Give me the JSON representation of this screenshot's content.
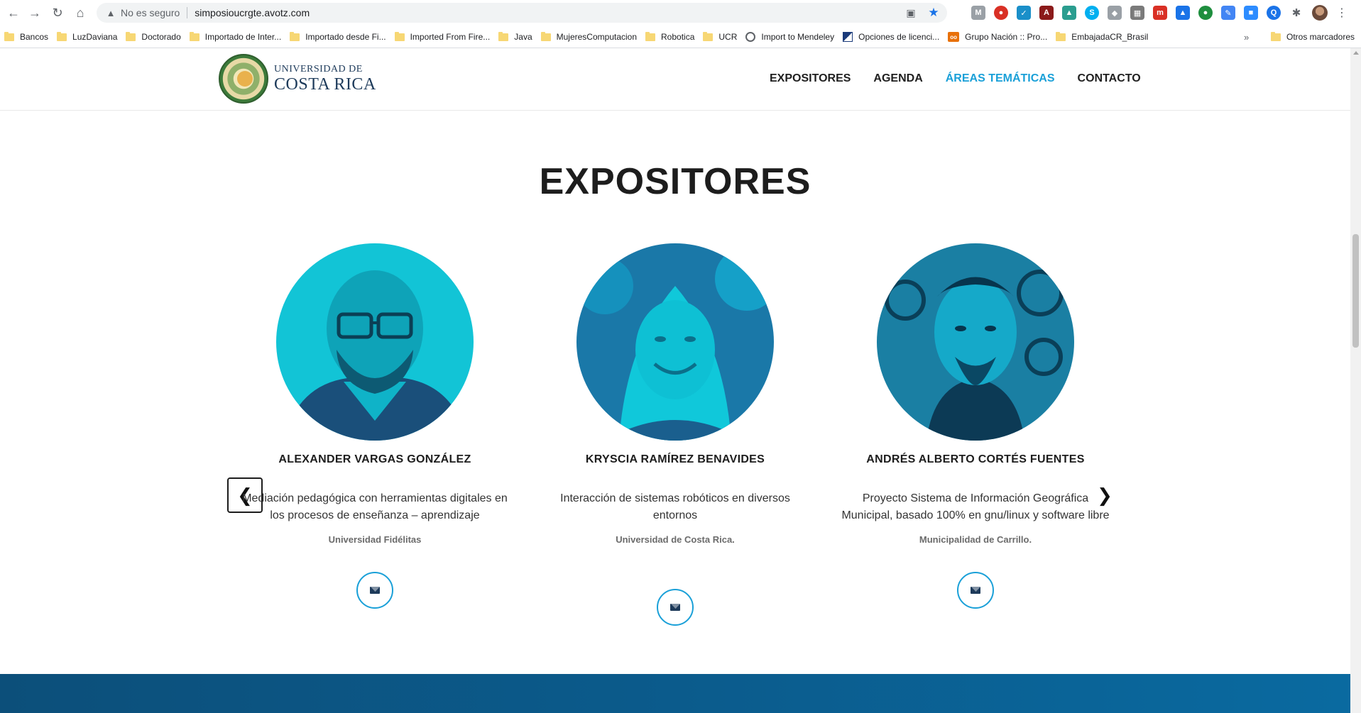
{
  "browser": {
    "security_label": "No es seguro",
    "url": "simposioucrgte.avotz.com",
    "bookmarks": [
      {
        "label": "Bancos",
        "icon": "folder-icon"
      },
      {
        "label": "LuzDaviana",
        "icon": "folder-icon"
      },
      {
        "label": "Doctorado",
        "icon": "folder-icon"
      },
      {
        "label": "Importado de Inter...",
        "icon": "folder-icon"
      },
      {
        "label": "Importado desde Fi...",
        "icon": "folder-icon"
      },
      {
        "label": "Imported From Fire...",
        "icon": "folder-icon"
      },
      {
        "label": "Java",
        "icon": "folder-icon"
      },
      {
        "label": "MujeresComputacion",
        "icon": "folder-icon"
      },
      {
        "label": "Robotica",
        "icon": "folder-icon"
      },
      {
        "label": "UCR",
        "icon": "folder-icon"
      },
      {
        "label": "Import to Mendeley",
        "icon": "globe-icon"
      },
      {
        "label": "Opciones de licenci...",
        "icon": "flag-icon"
      },
      {
        "label": "Grupo Nación :: Pro...",
        "icon": "news-icon"
      },
      {
        "label": "EmbajadaCR_Brasil",
        "icon": "folder-icon"
      }
    ],
    "more_bookmarks": "»",
    "other_bookmarks": "Otros marcadores"
  },
  "site": {
    "logo": {
      "line1": "UNIVERSIDAD DE",
      "line2": "COSTA RICA"
    },
    "nav": [
      {
        "label": "EXPOSITORES",
        "active": false
      },
      {
        "label": "AGENDA",
        "active": false
      },
      {
        "label": "ÁREAS TEMÁTICAS",
        "active": true
      },
      {
        "label": "CONTACTO",
        "active": false
      }
    ],
    "accent_color": "#1aa0d8"
  },
  "section": {
    "title": "EXPOSITORES",
    "speakers": [
      {
        "name": "ALEXANDER VARGAS GONZÁLEZ",
        "topic": "Mediación pedagógica con herramientas digitales en los procesos de enseñanza – aprendizaje",
        "organization": "Universidad Fidélitas"
      },
      {
        "name": "KRYSCIA RAMÍREZ BENAVIDES",
        "topic": "Interacción de sistemas robóticos en diversos entornos",
        "organization": "Universidad de Costa Rica."
      },
      {
        "name": "ANDRÉS ALBERTO CORTÉS FUENTES",
        "topic": "Proyecto Sistema de Información Geográfica Municipal, basado 100% en gnu/linux y software libre",
        "organization": "Municipalidad de Carrillo."
      }
    ]
  }
}
